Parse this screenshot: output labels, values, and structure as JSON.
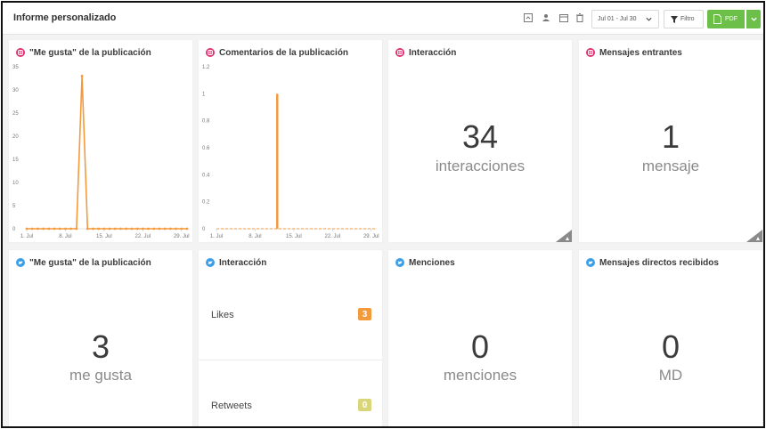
{
  "header": {
    "title": "Informe personalizado",
    "date_range": "Jul 01 - Jul 30",
    "filter_label": "Filtro",
    "pdf_label": "PDF"
  },
  "colors": {
    "accent_green": "#6cc04a",
    "instagram": "#e0306f",
    "twitter": "#3b9ee8",
    "chart_line": "#f39a3d",
    "badge_orange": "#f39a3d",
    "badge_yellow": "#d9d67a"
  },
  "cards": {
    "ig_likes": {
      "title": "\"Me gusta\" de la publicación",
      "network_icon": "instagram-icon"
    },
    "ig_comments": {
      "title": "Comentarios de la publicación",
      "network_icon": "instagram-icon"
    },
    "ig_interaction": {
      "title": "Interacción",
      "value": "34",
      "label": "interacciones",
      "network_icon": "instagram-icon"
    },
    "ig_messages": {
      "title": "Mensajes entrantes",
      "value": "1",
      "label": "mensaje",
      "network_icon": "instagram-icon"
    },
    "tw_likes": {
      "title": "\"Me gusta\" de la publicación",
      "value": "3",
      "label": "me gusta",
      "network_icon": "twitter-icon"
    },
    "tw_interaction": {
      "title": "Interacción",
      "rows": [
        {
          "label": "Likes",
          "value": "3"
        },
        {
          "label": "Retweets",
          "value": "0"
        }
      ],
      "network_icon": "twitter-icon"
    },
    "tw_mentions": {
      "title": "Menciones",
      "value": "0",
      "label": "menciones",
      "network_icon": "twitter-icon"
    },
    "tw_dm": {
      "title": "Mensajes directos recibidos",
      "value": "0",
      "label": "MD",
      "network_icon": "twitter-icon"
    }
  },
  "chart_data": [
    {
      "type": "line",
      "ylim": [
        0,
        35
      ],
      "yticks": [
        "0",
        "5",
        "10",
        "15",
        "20",
        "25",
        "30",
        "35"
      ],
      "xticks": [
        "1. Jul",
        "8. Jul",
        "15. Jul",
        "22. Jul",
        "29. Jul"
      ],
      "x": [
        1,
        2,
        3,
        4,
        5,
        6,
        7,
        8,
        9,
        10,
        11,
        12,
        13,
        14,
        15,
        16,
        17,
        18,
        19,
        20,
        21,
        22,
        23,
        24,
        25,
        26,
        27,
        28,
        29,
        30
      ],
      "series": [
        {
          "values": [
            0,
            0,
            0,
            0,
            0,
            0,
            0,
            0,
            0,
            0,
            33,
            0,
            0,
            0,
            0,
            0,
            0,
            0,
            0,
            0,
            0,
            0,
            0,
            0,
            0,
            0,
            0,
            0,
            0,
            0
          ]
        }
      ]
    },
    {
      "type": "line",
      "ylim": [
        0,
        1.2
      ],
      "yticks": [
        "0",
        "0.2",
        "0.4",
        "0.6",
        "0.8",
        "1",
        "1.2"
      ],
      "xticks": [
        "1. Jul",
        "8. Jul",
        "15. Jul",
        "22. Jul",
        "29. Jul"
      ],
      "x": [
        1,
        2,
        3,
        4,
        5,
        6,
        7,
        8,
        9,
        10,
        11,
        12,
        13,
        14,
        15,
        16,
        17,
        18,
        19,
        20,
        21,
        22,
        23,
        24,
        25,
        26,
        27,
        28,
        29,
        30
      ],
      "series": [
        {
          "values": [
            0,
            0,
            0,
            0,
            0,
            0,
            0,
            0,
            0,
            0,
            0,
            1,
            0,
            0,
            0,
            0,
            0,
            0,
            0,
            0,
            0,
            0,
            0,
            0,
            0,
            0,
            0,
            0,
            0,
            0
          ]
        }
      ]
    }
  ]
}
